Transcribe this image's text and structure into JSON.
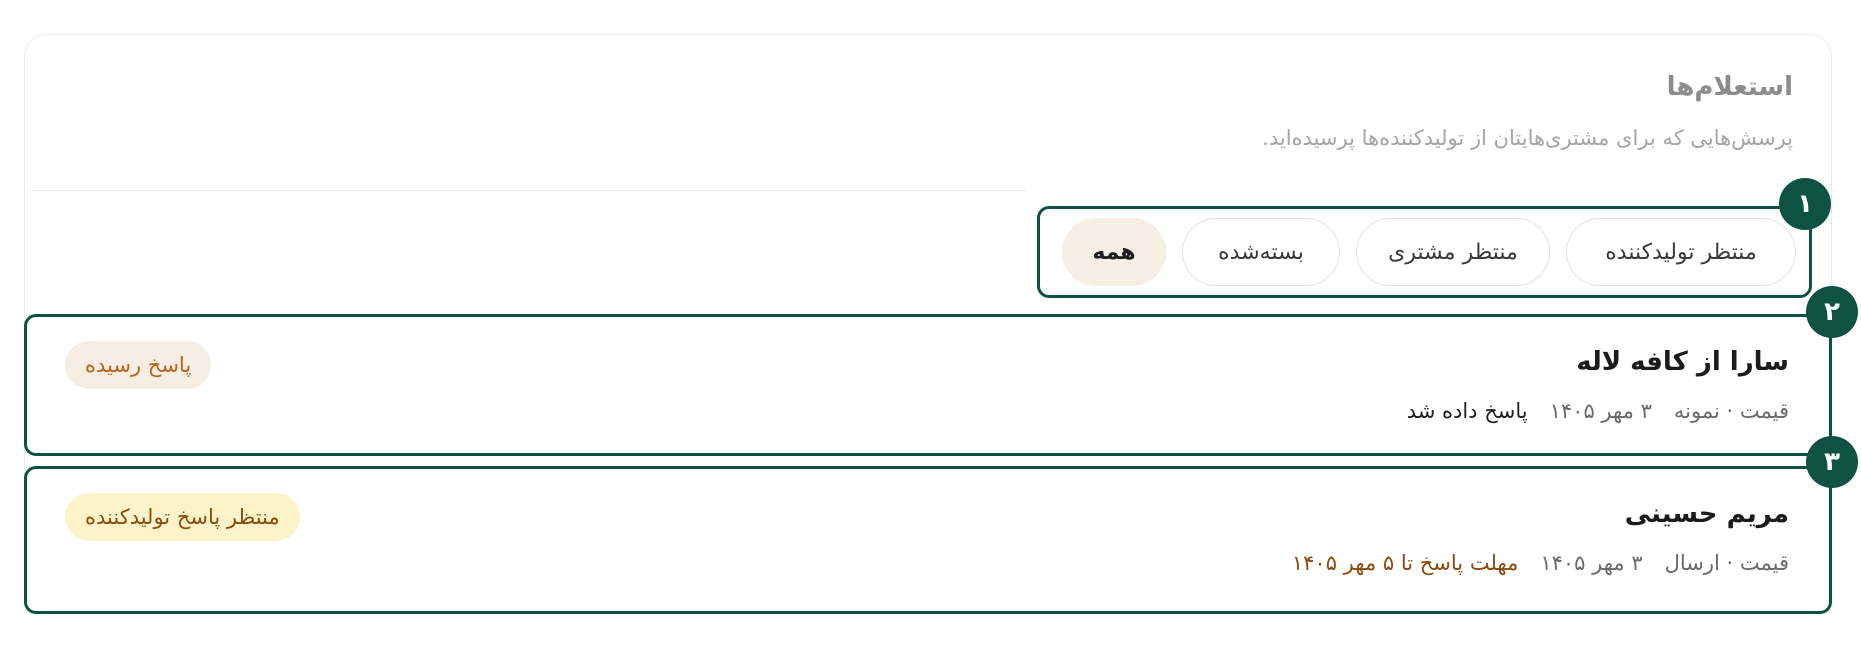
{
  "header": {
    "title": "استعلام‌ها",
    "subtitle": "پرسش‌هایی که برای مشتری‌هایتان از تولیدکننده‌ها پرسیده‌اید."
  },
  "filters": {
    "tabs": [
      {
        "label": "منتظر تولیدکننده",
        "active": false
      },
      {
        "label": "منتظر مشتری",
        "active": false
      },
      {
        "label": "بسته‌شده",
        "active": false
      },
      {
        "label": "همه",
        "active": true
      }
    ]
  },
  "inquiries": [
    {
      "name": "سارا از کافه لاله",
      "topic": "قیمت · نمونه",
      "date": "۳ مهر ۱۴۰۵",
      "status_text": "پاسخ داده شد",
      "badge": "پاسخ رسیده"
    },
    {
      "name": "مریم حسینی",
      "topic": "قیمت · ارسال",
      "date": "۳ مهر ۱۴۰۵",
      "deadline_text": "مهلت پاسخ تا ۵ مهر ۱۴۰۵",
      "badge": "منتظر پاسخ تولیدکننده"
    }
  ],
  "markers": [
    "۱",
    "۲",
    "۳"
  ],
  "colors": {
    "accent_green": "#0e5243",
    "badge_replied_bg": "#f6ede3",
    "badge_replied_text": "#b9661a",
    "badge_waiting_bg": "#fdf3c9",
    "badge_waiting_text": "#8a4b0e"
  }
}
